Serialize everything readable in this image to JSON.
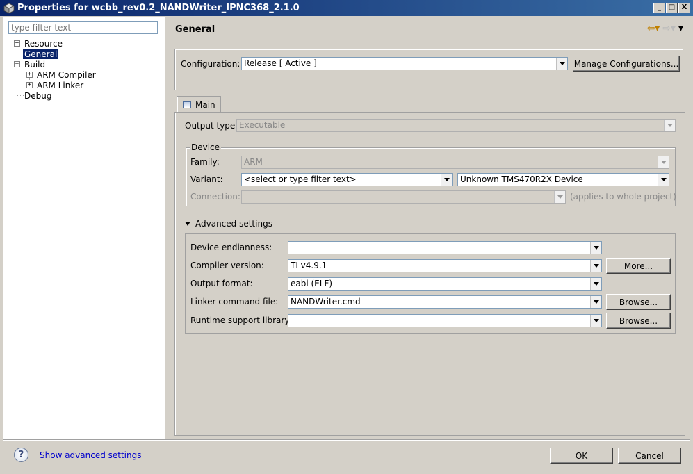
{
  "window": {
    "title": "Properties for wcbb_rev0.2_NANDWriter_IPNC368_2.1.0"
  },
  "titlebar_buttons": {
    "minimize": "_",
    "maximize": "□",
    "close": "X"
  },
  "tree": {
    "filter_placeholder": "type filter text",
    "items": [
      {
        "label": "Resource",
        "expander": "+"
      },
      {
        "label": "General"
      },
      {
        "label": "Build",
        "expander": "−"
      },
      {
        "label": "ARM Compiler",
        "expander": "+"
      },
      {
        "label": "ARM Linker",
        "expander": "+"
      },
      {
        "label": "Debug"
      }
    ]
  },
  "page": {
    "title": "General",
    "nav_icons": [
      "back-arrow-icon",
      "forward-arrow-icon",
      "menu-icon"
    ],
    "configuration": {
      "label": "Configuration:",
      "value": "Release  [ Active ]",
      "manage_button": "Manage Configurations..."
    },
    "tabs": [
      {
        "label": "Main"
      }
    ],
    "main": {
      "output_type_label": "Output type:",
      "output_type_value": "Executable",
      "device": {
        "legend": "Device",
        "family_label": "Family:",
        "family_value": "ARM",
        "variant_label": "Variant:",
        "variant_filter": "<select or type filter text>",
        "variant_value": "Unknown TMS470R2X Device",
        "connection_label": "Connection:",
        "connection_value": "",
        "connection_note": "(applies to whole project)"
      },
      "advanced": {
        "toggle_label": "Advanced settings",
        "rows": [
          {
            "label": "Device endianness:",
            "value": "",
            "button": ""
          },
          {
            "label": "Compiler version:",
            "value": "TI v4.9.1",
            "button": "More..."
          },
          {
            "label": "Output format:",
            "value": "eabi (ELF)",
            "button": ""
          },
          {
            "label": "Linker command file:",
            "value": "NANDWriter.cmd",
            "button": "Browse..."
          },
          {
            "label": "Runtime support library:",
            "value": "",
            "button": "Browse..."
          }
        ]
      }
    }
  },
  "footer": {
    "help_icon": "?",
    "show_advanced": "Show advanced settings",
    "ok": "OK",
    "cancel": "Cancel"
  }
}
